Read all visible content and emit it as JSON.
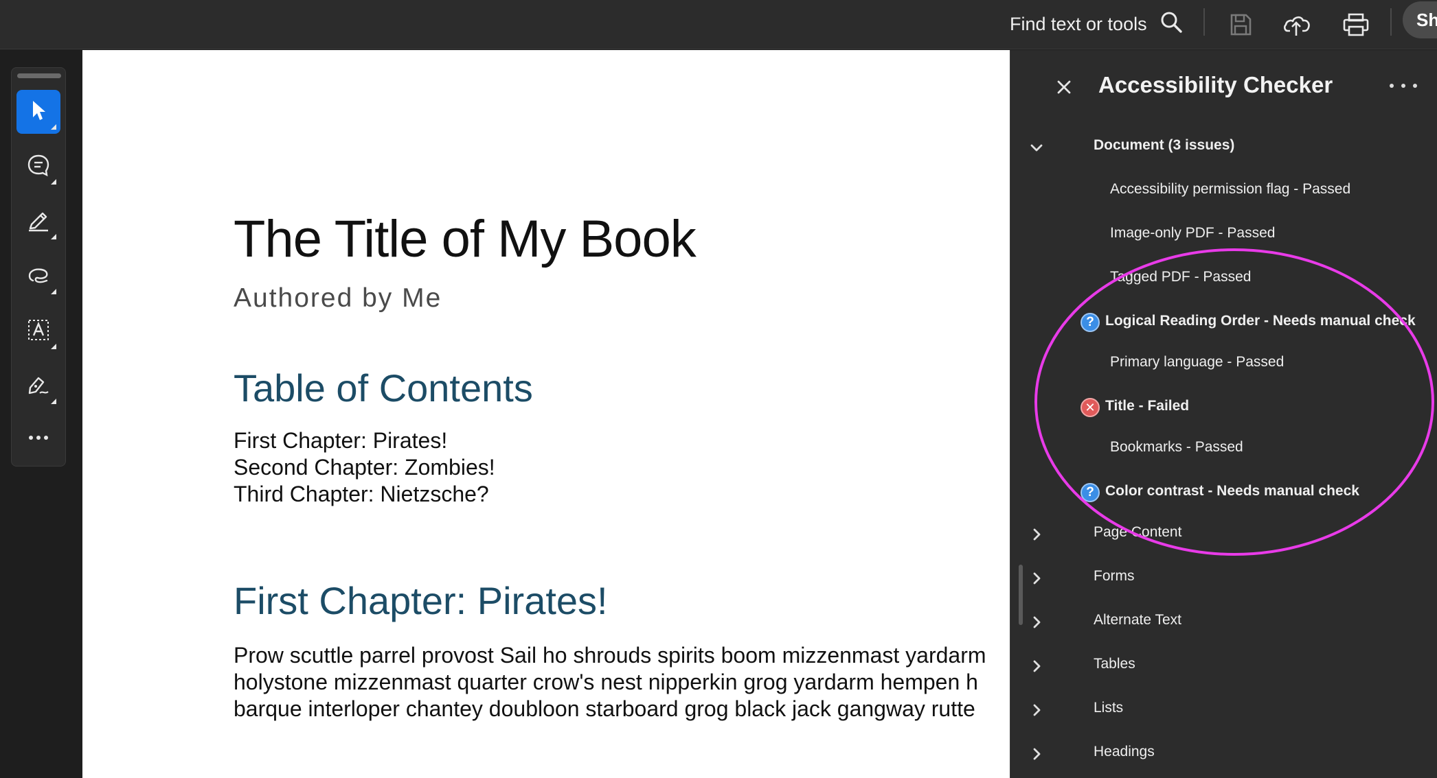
{
  "topbar": {
    "find_text": "Find text or tools",
    "share_label": "Sh"
  },
  "document": {
    "title": "The Title of My Book",
    "author": "Authored by Me",
    "toc_heading": "Table of Contents",
    "toc_items": [
      "First Chapter: Pirates!",
      "Second Chapter: Zombies!",
      "Third Chapter: Nietzsche?"
    ],
    "chapter_heading": "First Chapter: Pirates!",
    "chapter_lines": [
      "Prow scuttle parrel provost Sail ho shrouds spirits boom mizzenmast yardarm",
      "holystone mizzenmast quarter crow's nest nipperkin grog yardarm hempen h",
      "barque interloper chantey doubloon starboard grog black jack gangway rutte"
    ]
  },
  "panel": {
    "title": "Accessibility Checker",
    "document_group": {
      "label": "Document (3 issues)",
      "items": [
        {
          "label": "Accessibility permission flag - Passed",
          "status": "passed"
        },
        {
          "label": "Image-only PDF - Passed",
          "status": "passed"
        },
        {
          "label": "Tagged PDF - Passed",
          "status": "passed"
        },
        {
          "label": "Logical Reading Order - Needs manual check",
          "status": "manual"
        },
        {
          "label": "Primary language - Passed",
          "status": "passed"
        },
        {
          "label": "Title - Failed",
          "status": "failed"
        },
        {
          "label": "Bookmarks - Passed",
          "status": "passed"
        },
        {
          "label": "Color contrast - Needs manual check",
          "status": "manual"
        }
      ]
    },
    "collapsed_groups": [
      "Page Content",
      "Forms",
      "Alternate Text",
      "Tables",
      "Lists",
      "Headings"
    ]
  },
  "colors": {
    "accent_blue": "#1473e6",
    "heading_blue": "#1c4c66",
    "annotation_magenta": "#e83be8",
    "failed_red": "#e05a5a",
    "manual_blue": "#3b8ee6"
  },
  "icons": {
    "topbar": [
      "search-icon",
      "save-icon",
      "cloud-upload-icon",
      "print-icon"
    ],
    "tools": [
      "select-cursor-icon",
      "comment-icon",
      "highlight-pen-icon",
      "lasso-draw-icon",
      "text-box-icon",
      "sign-icon",
      "more-tools-icon"
    ]
  }
}
